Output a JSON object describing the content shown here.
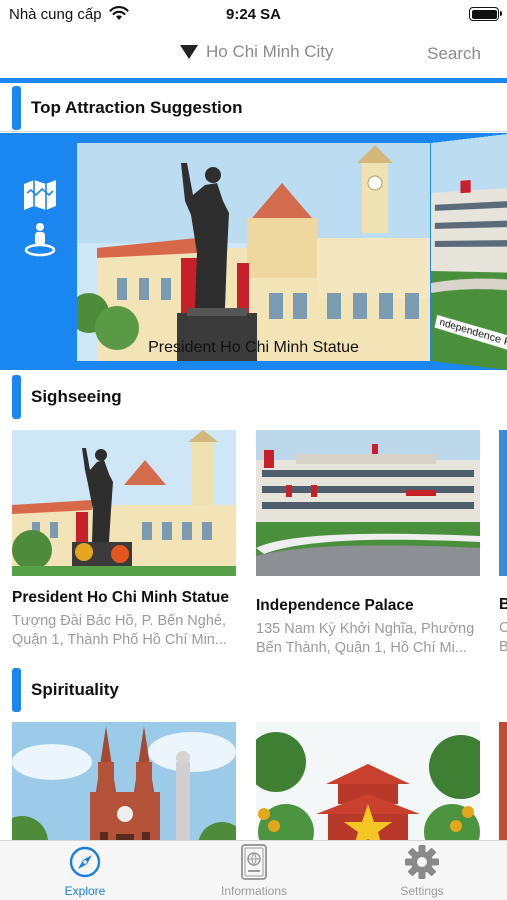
{
  "status_bar": {
    "carrier": "Nhà cung cấp",
    "time": "9:24 SA",
    "wifi_icon": "wifi-icon",
    "battery_icon": "battery-icon"
  },
  "nav": {
    "city": "Ho Chi Minh City",
    "search": "Search",
    "dropdown_icon": "triangle-down-icon"
  },
  "top_attraction": {
    "title": "Top Attraction Suggestion",
    "map_icon": "map-icon",
    "location_icon": "person-location-icon",
    "slides": [
      {
        "caption": "President Ho Chi Minh Statue"
      },
      {
        "caption": "ndependence Palace"
      }
    ]
  },
  "sightseeing": {
    "title": "Sighseeing",
    "cards": [
      {
        "name": "President Ho Chi Minh Statue",
        "address": "Tượng Đài Bác Hồ, P. Bến Nghé, Quận 1, Thành Phố Hồ Chí Min..."
      },
      {
        "name": "Independence Palace",
        "address": "135 Nam Kỳ Khởi Nghĩa, Phường Bến Thành, Quận 1, Hồ Chí Mi..."
      },
      {
        "name": "B",
        "address": "C B"
      }
    ]
  },
  "spirituality": {
    "title": "Spirituality"
  },
  "tabbar": {
    "items": [
      {
        "label": "Explore",
        "icon": "compass-icon",
        "active": true
      },
      {
        "label": "Informations",
        "icon": "passport-icon",
        "active": false
      },
      {
        "label": "Settings",
        "icon": "gear-icon",
        "active": false
      }
    ]
  },
  "colors": {
    "accent": "#1a86f0",
    "tab_active": "#1a7fe0",
    "tab_inactive": "#9b9b9b",
    "subtitle": "#9a9a9a"
  }
}
